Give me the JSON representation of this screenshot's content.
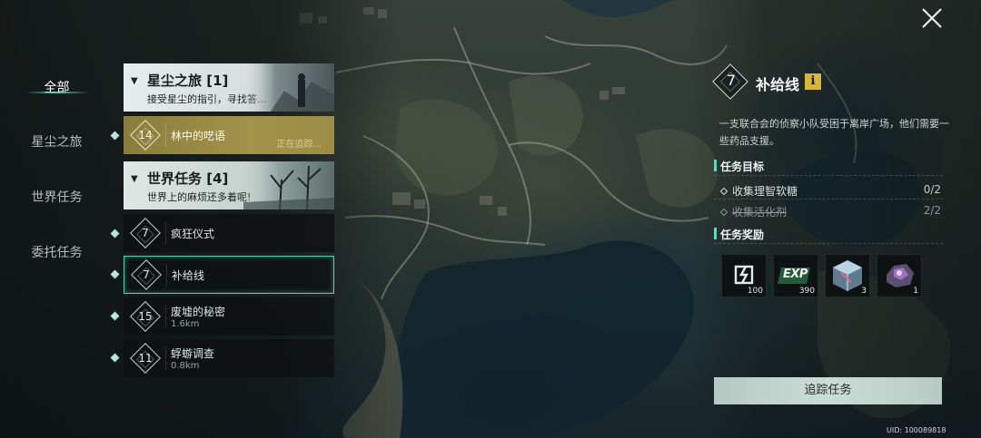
{
  "categories": [
    {
      "label": "全部",
      "active": true
    },
    {
      "label": "星尘之旅",
      "active": false
    },
    {
      "label": "世界任务",
      "active": false
    },
    {
      "label": "委托任务",
      "active": false
    }
  ],
  "quest_list": {
    "star_group": {
      "title": "星尘之旅 [1]",
      "subtitle": "接受星尘的指引，寻找答..."
    },
    "tracked_quest": {
      "level": "14",
      "name": "林中的呓语",
      "status": "正在追踪..."
    },
    "world_group": {
      "title": "世界任务 [4]",
      "subtitle": "世界上的麻烦还多着呢!"
    },
    "world_quests": [
      {
        "level": "7",
        "name": "疯狂仪式",
        "distance": ""
      },
      {
        "level": "7",
        "name": "补给线",
        "distance": ""
      },
      {
        "level": "15",
        "name": "废墟的秘密",
        "distance": "1.6km"
      },
      {
        "level": "11",
        "name": "蜉蝣调查",
        "distance": "0.8km"
      }
    ]
  },
  "detail": {
    "level": "7",
    "title": "补给线",
    "description": "一支联合会的侦察小队受困于离岸广场，他们需要一些药品支援。",
    "objectives_title": "任务目标",
    "objectives": [
      {
        "label": "收集理智软糖",
        "count": "0/2",
        "done": false
      },
      {
        "label": "收集活化剂",
        "count": "2/2",
        "done": true
      }
    ],
    "rewards_title": "任务奖励",
    "rewards": [
      {
        "icon": "currency-icon",
        "qty": "100"
      },
      {
        "icon": "exp-icon",
        "qty": "390"
      },
      {
        "icon": "crystal-cube-icon",
        "qty": "3"
      },
      {
        "icon": "ore-icon",
        "qty": "1"
      }
    ],
    "track_button": "追踪任务"
  },
  "uid": "UID: 100089818",
  "colors": {
    "accent": "#4fd0b5",
    "tracking": "#a39249",
    "info": "#d7b43a",
    "button": "#c5d7d0"
  }
}
